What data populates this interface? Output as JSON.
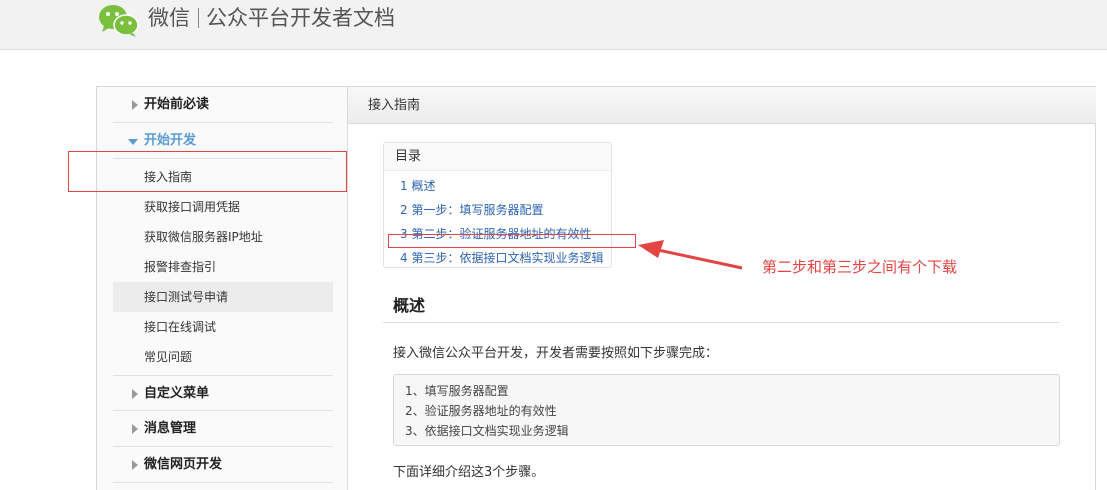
{
  "header": {
    "brand_name": "微信",
    "brand_subtitle": "公众平台开发者文档",
    "logo_icon": "wechat-logo-icon",
    "logo_color": "#7bbf3f"
  },
  "sidebar": {
    "groups": [
      {
        "label": "开始前必读",
        "expanded": false
      },
      {
        "label": "开始开发",
        "expanded": true
      },
      {
        "label": "自定义菜单",
        "expanded": false
      },
      {
        "label": "消息管理",
        "expanded": false
      },
      {
        "label": "微信网页开发",
        "expanded": false
      }
    ],
    "items": [
      {
        "label": "接入指南",
        "selected": true
      },
      {
        "label": "获取接口调用凭据"
      },
      {
        "label": "获取微信服务器IP地址"
      },
      {
        "label": "报警排查指引"
      },
      {
        "label": "接口测试号申请"
      },
      {
        "label": "接口在线调试"
      },
      {
        "label": "常见问题"
      }
    ]
  },
  "content": {
    "header_title": "接入指南",
    "toc": {
      "title": "目录",
      "items": [
        "1 概述",
        "2 第一步：填写服务器配置",
        "3 第二步：验证服务器地址的有效性",
        "4 第三步：依据接口文档实现业务逻辑"
      ]
    },
    "section_title": "概述",
    "intro": "接入微信公众平台开发，开发者需要按照如下步骤完成：",
    "steps": [
      "1、填写服务器配置",
      "2、验证服务器地址的有效性",
      "3、依据接口文档实现业务逻辑"
    ],
    "outro": "下面详细介绍这3个步骤。"
  },
  "annotation": {
    "text": "第二步和第三步之间有个下载",
    "color": "#e34545"
  },
  "colors": {
    "link": "#2d64b3",
    "accent": "#5a9bd4"
  }
}
